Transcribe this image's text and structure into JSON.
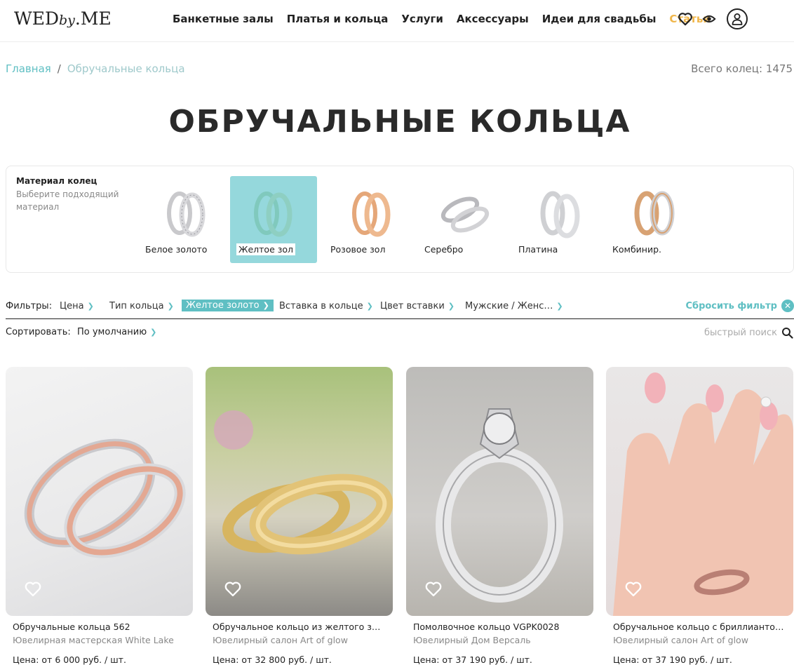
{
  "header": {
    "logo_main": "WED",
    "logo_by": "by",
    "logo_end": ".ME",
    "nav": [
      "Банкетные залы",
      "Платья и кольца",
      "Услуги",
      "Аксессуары",
      "Идеи для свадьбы",
      "Статьи"
    ],
    "accent_color": "#f0b64a"
  },
  "breadcrumbs": {
    "home": "Главная",
    "separator": "/",
    "current": "Обручальные кольца"
  },
  "total": {
    "label": "Всего колец:",
    "count": "1475"
  },
  "page_title": "ОБРУЧАЛЬНЫЕ КОЛЬЦА",
  "material": {
    "title": "Материал колец",
    "subtitle": "Выберите подходящий материал",
    "items": [
      {
        "label": "Белое золото",
        "selected": false
      },
      {
        "label": "Желтое зол",
        "selected": true
      },
      {
        "label": "Розовое зол",
        "selected": false
      },
      {
        "label": "Серебро",
        "selected": false
      },
      {
        "label": "Платина",
        "selected": false
      },
      {
        "label": "Комбинир.",
        "selected": false
      }
    ]
  },
  "filters": {
    "label": "Фильтры:",
    "items": [
      "Цена",
      "Тип кольца",
      "Желтое золото",
      "Вставка в кольце",
      "Цвет вставки",
      "Мужские / Женс…"
    ],
    "active_index": 2,
    "reset": "Сбросить фильтр"
  },
  "sort": {
    "label": "Сортировать:",
    "value": "По умолчанию",
    "quick_search_placeholder": "быстрый поиск"
  },
  "accent_teal": "#5fbfc3",
  "products": [
    {
      "name": "Обручальные кольца 562",
      "shop": "Ювелирная мастерская White Lake",
      "price": "Цена: от 6 000 руб. / шт."
    },
    {
      "name": "Обручальное кольцо из желтого золо…",
      "shop": "Ювелирный салон Art of glow",
      "price": "Цена: от 32 800 руб. / шт."
    },
    {
      "name": "Помолвочное кольцо VGPK0028",
      "shop": "Ювелирный Дом Версаль",
      "price": "Цена: от 37 190 руб. / шт."
    },
    {
      "name": "Обручальное кольцо с бриллиантово…",
      "shop": "Ювелирный салон Art of glow",
      "price": "Цена: от 37 190 руб. / шт."
    }
  ]
}
